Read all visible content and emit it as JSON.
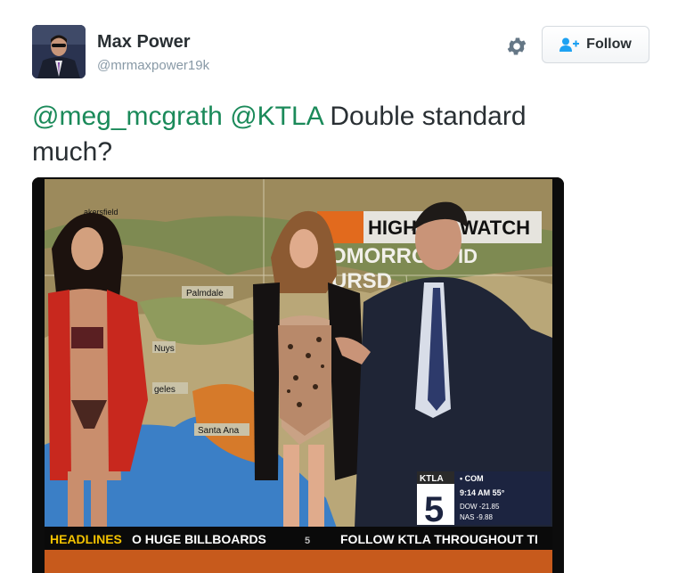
{
  "user": {
    "name": "Max Power",
    "handle": "@mrmaxpower19k"
  },
  "actions": {
    "follow_label": "Follow"
  },
  "tweet": {
    "mention1": "@meg_mcgrath",
    "mention2": "@KTLA",
    "text_rest": "Double standard much?"
  },
  "media": {
    "map_labels": {
      "bakersfield": "akersfield",
      "palmdale": "Palmdale",
      "nuys": "Nuys",
      "angeles": "geles",
      "santa_ana": "Santa Ana"
    },
    "banner": {
      "left": "HIGH",
      "right": "WATCH",
      "line2": "OMORRO",
      "line2_end": "ID",
      "line3": "URSD"
    },
    "logo": {
      "station": "KTLA",
      "channel": "5",
      "com": "• COM",
      "time": "9:14 AM  55°",
      "dow": "DOW  -21.85",
      "nas": "NAS   -9.88"
    },
    "ticker": {
      "headlines": "HEADLINES",
      "item1": "O HUGE BILLBOARDS",
      "sep": "5",
      "item2": "FOLLOW KTLA THROUGHOUT TI"
    }
  },
  "colors": {
    "mention": "#1b8a5a",
    "follow_icon": "#1da1f2",
    "ticker_orange": "#e8681c",
    "ticker_yellow": "#f3c200"
  },
  "icons": {
    "settings": "gear-icon",
    "follow": "add-user-icon"
  }
}
